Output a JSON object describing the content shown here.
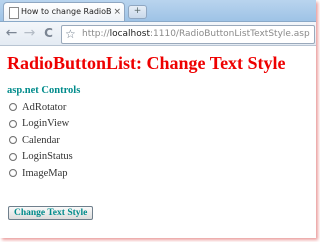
{
  "browser": {
    "tab_title": "How to change RadioButto...",
    "tab_close": "×",
    "new_tab": "+",
    "back_glyph": "←",
    "forward_glyph": "→",
    "reload_glyph": "C",
    "star_glyph": "☆",
    "url_prefix": "http://",
    "url_host": "localhost",
    "url_rest": ":1110/RadioButtonListTextStyle.aspx"
  },
  "page": {
    "title": "RadioButtonList: Change Text Style",
    "section_heading": "asp.net Controls",
    "options": [
      "AdRotator",
      "LoginView",
      "Calendar",
      "LoginStatus",
      "ImageMap"
    ],
    "button_label": "Change Text Style"
  },
  "colors": {
    "title": "#ee0000",
    "heading": "#008b8b",
    "button_text": "#008b8b"
  },
  "icons": {
    "tab": "page-icon",
    "back": "back-arrow-icon",
    "forward": "forward-arrow-icon",
    "reload": "reload-icon",
    "bookmark": "star-icon"
  }
}
